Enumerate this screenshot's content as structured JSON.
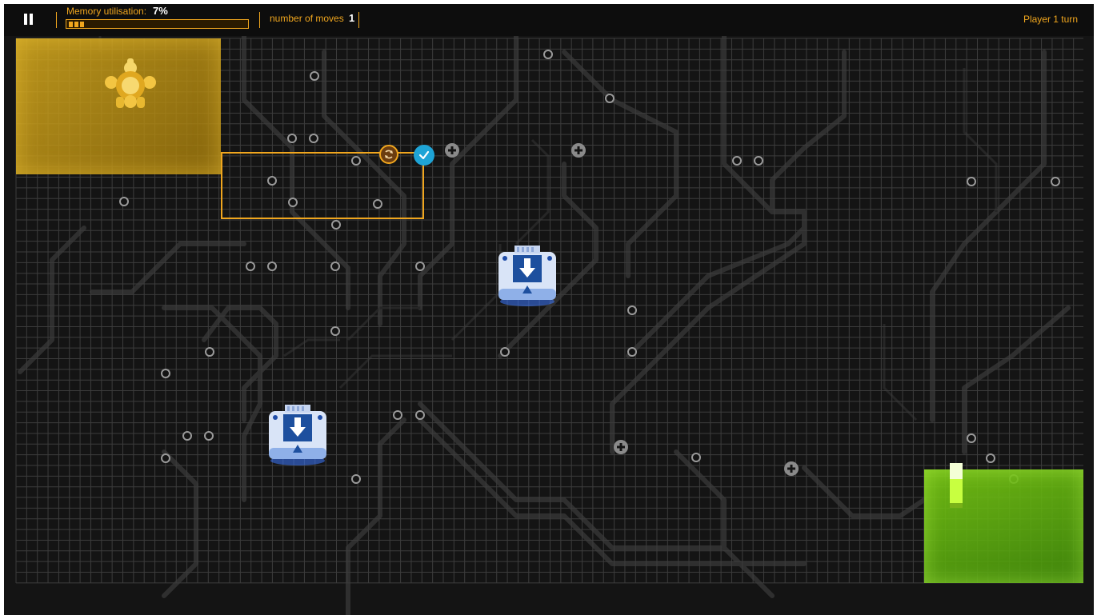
{
  "hud": {
    "pause_icon": "pause-icon",
    "memory_label": "Memory utilisation:",
    "memory_value": "7%",
    "memory_fraction": 0.07,
    "moves_label": "number of moves",
    "moves_value": "1",
    "turn_label": "Player 1 turn"
  },
  "board": {
    "colors": {
      "background": "#141414",
      "grid": "#4a4a4a",
      "trace": "#3a3a3a",
      "accent": "#f0a61e",
      "confirm": "#1ea4d6",
      "player1_zone": "#d6aa1e",
      "player2_zone": "#78c814"
    },
    "player1_piece_icon": "robot-turret-icon",
    "player2_piece_icon": "data-bar-icon",
    "units": [
      {
        "icon": "download-chip-icon"
      },
      {
        "icon": "download-chip-icon"
      }
    ],
    "selection": {
      "rotate_icon": "rotate-icon",
      "confirm_icon": "check-icon"
    }
  }
}
